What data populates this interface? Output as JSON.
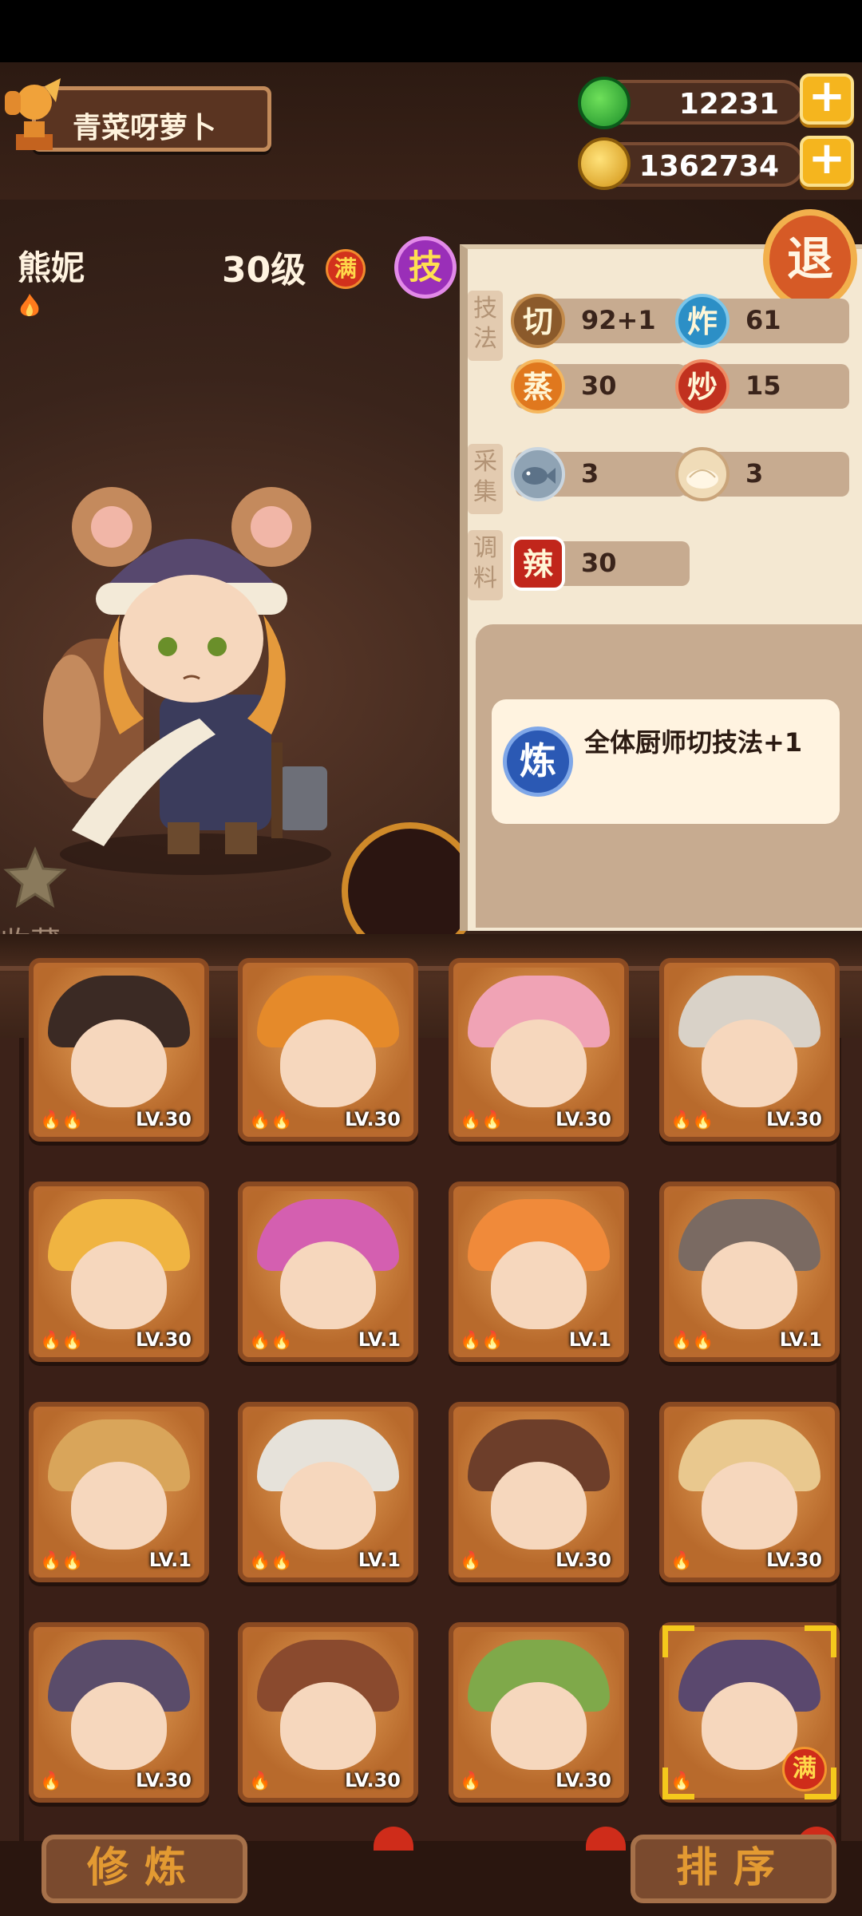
{
  "header": {
    "player_name": "青菜呀萝卜",
    "jade": "12231",
    "coins": "1362734",
    "plus": "+"
  },
  "chef": {
    "name": "熊妮",
    "level": "30级",
    "full_badge": "满",
    "skill_badge": "技",
    "collect_label": "收藏",
    "return_label": "退"
  },
  "stats": {
    "technique_label": "技法",
    "gather_label": "采集",
    "seasoning_label": "调料",
    "technique": [
      {
        "icon": "切",
        "value": "92+1",
        "color": "#8b5a2b"
      },
      {
        "icon": "炸",
        "value": "61",
        "color": "#2c8fc6"
      },
      {
        "icon": "蒸",
        "value": "30",
        "color": "#e0781e"
      },
      {
        "icon": "炒",
        "value": "15",
        "color": "#c1311f"
      }
    ],
    "gather": [
      {
        "icon": "fish-icon",
        "value": "3"
      },
      {
        "icon": "bun-icon",
        "value": "3"
      }
    ],
    "seasoning": [
      {
        "icon": "辣",
        "value": "30"
      }
    ],
    "note_icon": "炼",
    "note_text": "全体厨师切技法+1"
  },
  "grid": {
    "rows": [
      [
        {
          "lv": "LV.30",
          "flames": "🔥🔥"
        },
        {
          "lv": "LV.30",
          "flames": "🔥🔥"
        },
        {
          "lv": "LV.30",
          "flames": "🔥🔥"
        },
        {
          "lv": "LV.30",
          "flames": "🔥🔥"
        }
      ],
      [
        {
          "lv": "LV.30",
          "flames": "🔥🔥"
        },
        {
          "lv": "LV.1",
          "flames": "🔥🔥"
        },
        {
          "lv": "LV.1",
          "flames": "🔥🔥"
        },
        {
          "lv": "LV.1",
          "flames": "🔥🔥"
        }
      ],
      [
        {
          "lv": "LV.1",
          "flames": "🔥🔥"
        },
        {
          "lv": "LV.1",
          "flames": "🔥🔥"
        },
        {
          "lv": "LV.30",
          "flames": "🔥"
        },
        {
          "lv": "LV.30",
          "flames": "🔥"
        }
      ],
      [
        {
          "lv": "LV.30",
          "flames": "🔥"
        },
        {
          "lv": "LV.30",
          "flames": "🔥"
        },
        {
          "lv": "LV.30",
          "flames": "🔥"
        },
        {
          "lv": "满",
          "flames": "🔥"
        }
      ]
    ]
  },
  "bottom": {
    "train_label": "修炼",
    "sort_label": "排序"
  }
}
